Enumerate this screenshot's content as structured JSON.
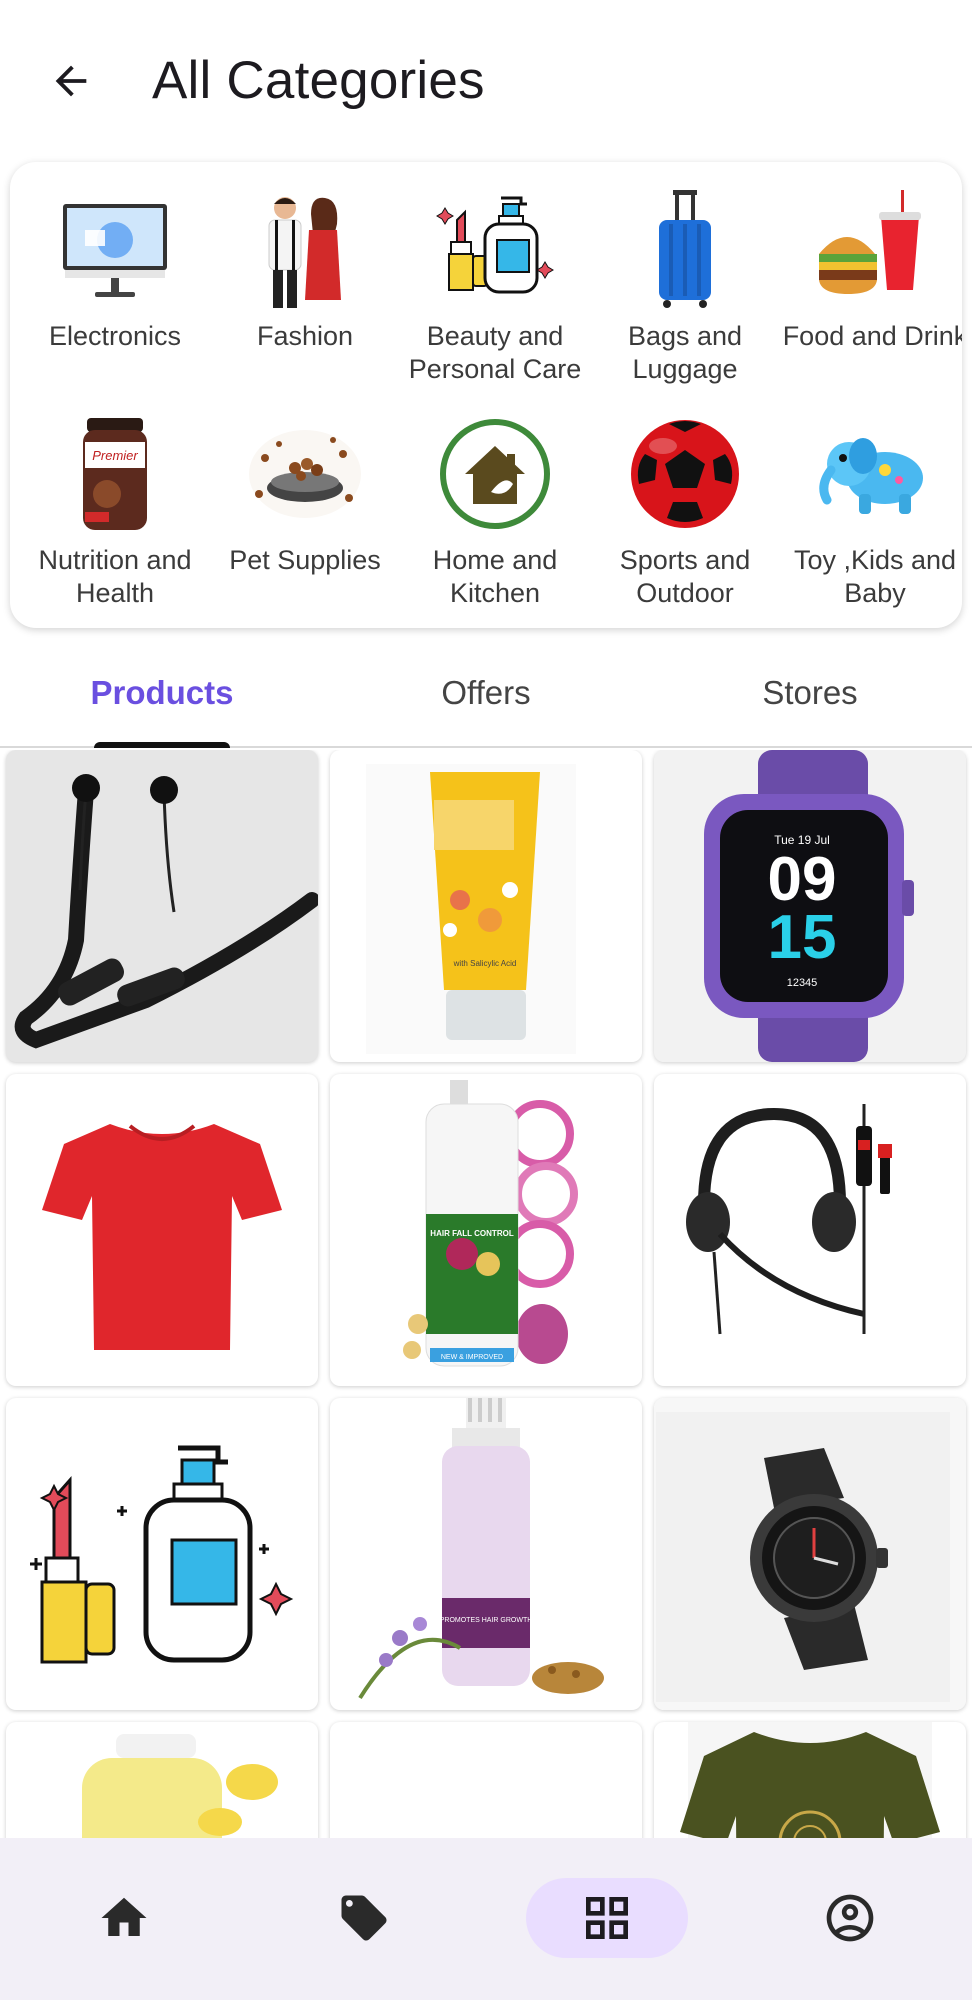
{
  "header": {
    "title": "All Categories"
  },
  "categories": [
    {
      "label": "Electronics",
      "icon": "computer-monitor-icon"
    },
    {
      "label": "Fashion",
      "icon": "fashion-couple-icon"
    },
    {
      "label": "Beauty and Personal Care",
      "line1": "Beauty and",
      "line2": "Personal Care",
      "icon": "cosmetics-icon"
    },
    {
      "label": "Bags and Luggage",
      "line1": "Bags and",
      "line2": "Luggage",
      "icon": "suitcase-icon"
    },
    {
      "label": "Food and Drink",
      "icon": "burger-drink-icon"
    },
    {
      "label": "Nutrition and Health",
      "line1": "Nutrition and",
      "line2": "Health",
      "icon": "protein-jar-icon"
    },
    {
      "label": "Pet Supplies",
      "icon": "pet-bowl-icon"
    },
    {
      "label": "Home and Kitchen",
      "line1": "Home and",
      "line2": "Kitchen",
      "icon": "home-leaf-icon"
    },
    {
      "label": "Sports and Outdoor",
      "line1": "Sports and",
      "line2": "Outdoor",
      "icon": "football-icon"
    },
    {
      "label": "Toy ,Kids and Baby",
      "line1": "Toy ,Kids and",
      "line2": "Baby",
      "icon": "toy-elephant-icon"
    }
  ],
  "tabs": [
    {
      "label": "Products",
      "active": true
    },
    {
      "label": "Offers",
      "active": false
    },
    {
      "label": "Stores",
      "active": false
    }
  ],
  "products": {
    "watch_time_hours": "09",
    "watch_time_minutes": "15",
    "watch_date": "Tue 19 Jul",
    "watch_steps": "12345",
    "serum_text": "with Salicylic Acid",
    "onion_label": "HAIR FALL CONTROL",
    "onion_badge": "NEW & IMPROVED",
    "oil_label": "PROMOTES HAIR GROWTH"
  },
  "bottom_nav": [
    {
      "icon": "home-icon"
    },
    {
      "icon": "tag-icon"
    },
    {
      "icon": "grid-icon",
      "active": true
    },
    {
      "icon": "account-circle-icon"
    }
  ],
  "colors": {
    "accent": "#6a4fe0",
    "nav_bg": "#f2eff7",
    "nav_active": "#e9ddff"
  }
}
